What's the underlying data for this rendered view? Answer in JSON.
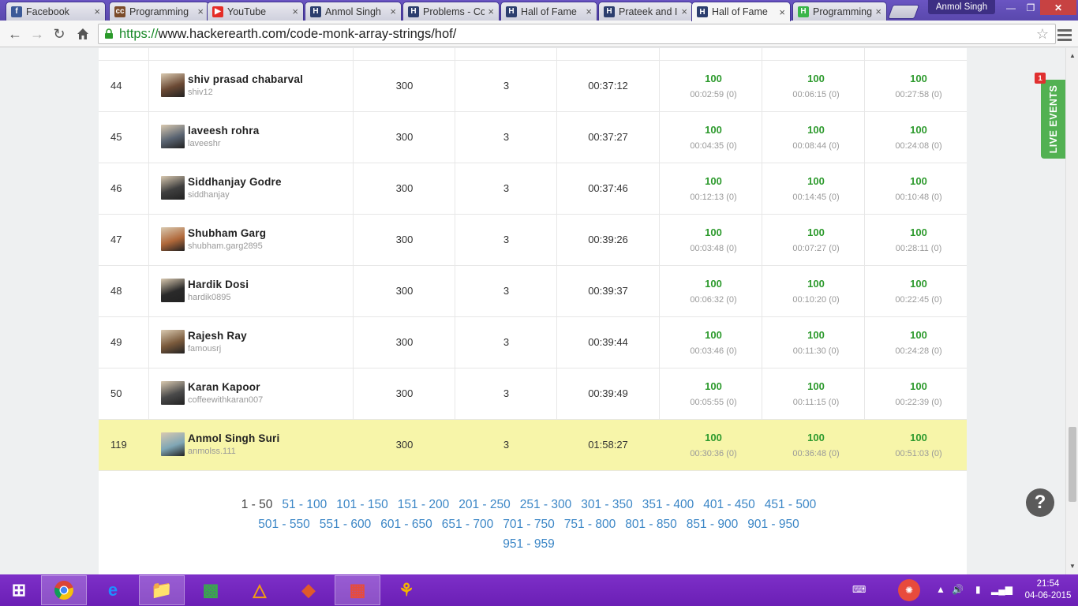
{
  "browser": {
    "tabs": [
      {
        "label": "Facebook",
        "icon": "facebook-icon",
        "color": "#3b5998",
        "glyph": "f"
      },
      {
        "label": "Programming",
        "icon": "codechef-icon",
        "color": "#7b4b2a",
        "glyph": "cc"
      },
      {
        "label": "YouTube",
        "icon": "youtube-icon",
        "color": "#e52d27",
        "glyph": "▶"
      },
      {
        "label": "Anmol Singh",
        "icon": "hackerearth-icon",
        "color": "#2c3e6e",
        "glyph": "H"
      },
      {
        "label": "Problems - Co",
        "icon": "hackerearth-icon",
        "color": "#2c3e6e",
        "glyph": "H"
      },
      {
        "label": "Hall of Fame",
        "icon": "hackerearth-icon",
        "color": "#2c3e6e",
        "glyph": "H"
      },
      {
        "label": "Prateek and I",
        "icon": "hackerearth-icon",
        "color": "#2c3e6e",
        "glyph": "H"
      },
      {
        "label": "Hall of Fame",
        "icon": "hackerearth-icon",
        "color": "#2c3e6e",
        "glyph": "H",
        "active": true
      },
      {
        "label": "Programming",
        "icon": "hackerrank-icon",
        "color": "#39b54a",
        "glyph": "H"
      }
    ],
    "user": "Anmol Singh",
    "url_scheme": "https://",
    "url_rest": "www.hackerearth.com/code-monk-array-strings/hof/"
  },
  "leaderboard": {
    "rows": [
      {
        "rank": "44",
        "name": "shiv prasad chabarval",
        "handle": "shiv12",
        "score": "300",
        "solved": "3",
        "time": "00:37:12",
        "problems": [
          {
            "score": "100",
            "time": "00:02:59 (0)"
          },
          {
            "score": "100",
            "time": "00:06:15 (0)"
          },
          {
            "score": "100",
            "time": "00:27:58 (0)"
          }
        ],
        "avatar": "#6b4a35"
      },
      {
        "rank": "45",
        "name": "laveesh rohra",
        "handle": "laveeshr",
        "score": "300",
        "solved": "3",
        "time": "00:37:27",
        "problems": [
          {
            "score": "100",
            "time": "00:04:35 (0)"
          },
          {
            "score": "100",
            "time": "00:08:44 (0)"
          },
          {
            "score": "100",
            "time": "00:24:08 (0)"
          }
        ],
        "avatar": "#5a6472"
      },
      {
        "rank": "46",
        "name": "Siddhanjay Godre",
        "handle": "siddhanjay",
        "score": "300",
        "solved": "3",
        "time": "00:37:46",
        "problems": [
          {
            "score": "100",
            "time": "00:12:13 (0)"
          },
          {
            "score": "100",
            "time": "00:14:45 (0)"
          },
          {
            "score": "100",
            "time": "00:10:48 (0)"
          }
        ],
        "avatar": "#3f3f3f"
      },
      {
        "rank": "47",
        "name": "Shubham Garg",
        "handle": "shubham.garg2895",
        "score": "300",
        "solved": "3",
        "time": "00:39:26",
        "problems": [
          {
            "score": "100",
            "time": "00:03:48 (0)"
          },
          {
            "score": "100",
            "time": "00:07:27 (0)"
          },
          {
            "score": "100",
            "time": "00:28:11 (0)"
          }
        ],
        "avatar": "#b0683a"
      },
      {
        "rank": "48",
        "name": "Hardik Dosi",
        "handle": "hardik0895",
        "score": "300",
        "solved": "3",
        "time": "00:39:37",
        "problems": [
          {
            "score": "100",
            "time": "00:06:32 (0)"
          },
          {
            "score": "100",
            "time": "00:10:20 (0)"
          },
          {
            "score": "100",
            "time": "00:22:45 (0)"
          }
        ],
        "avatar": "#2a2a2a"
      },
      {
        "rank": "49",
        "name": "Rajesh Ray",
        "handle": "famousrj",
        "score": "300",
        "solved": "3",
        "time": "00:39:44",
        "problems": [
          {
            "score": "100",
            "time": "00:03:46 (0)"
          },
          {
            "score": "100",
            "time": "00:11:30 (0)"
          },
          {
            "score": "100",
            "time": "00:24:28 (0)"
          }
        ],
        "avatar": "#7a5a3c"
      },
      {
        "rank": "50",
        "name": "Karan Kapoor",
        "handle": "coffeewithkaran007",
        "score": "300",
        "solved": "3",
        "time": "00:39:49",
        "problems": [
          {
            "score": "100",
            "time": "00:05:55 (0)"
          },
          {
            "score": "100",
            "time": "00:11:15 (0)"
          },
          {
            "score": "100",
            "time": "00:22:39 (0)"
          }
        ],
        "avatar": "#4a4a4a"
      },
      {
        "rank": "119",
        "name": "Anmol Singh Suri",
        "handle": "anmolss.111",
        "score": "300",
        "solved": "3",
        "time": "01:58:27",
        "problems": [
          {
            "score": "100",
            "time": "00:30:36 (0)"
          },
          {
            "score": "100",
            "time": "00:36:48 (0)"
          },
          {
            "score": "100",
            "time": "00:51:03 (0)"
          }
        ],
        "avatar": "#7fa6b5",
        "highlight": true
      }
    ],
    "colors": {
      "score_green": "#2d9a2d",
      "highlight": "#f7f5a9"
    }
  },
  "pagination": [
    [
      "1 - 50",
      "51 - 100",
      "101 - 150",
      "151 - 200",
      "201 - 250",
      "251 - 300",
      "301 - 350",
      "351 - 400",
      "401 - 450",
      "451 - 500"
    ],
    [
      "501 - 550",
      "551 - 600",
      "601 - 650",
      "651 - 700",
      "701 - 750",
      "751 - 800",
      "801 - 850",
      "851 - 900",
      "901 - 950"
    ],
    [
      "951 - 959"
    ]
  ],
  "live_events": {
    "label": "LIVE EVENTS",
    "count": "1"
  },
  "help": {
    "glyph": "?"
  },
  "taskbar": {
    "items": [
      "windows-start-icon",
      "chrome-icon",
      "internet-explorer-icon",
      "file-explorer-icon",
      "windows-store-icon",
      "vlc-icon",
      "git-icon",
      "winrar-icon",
      "paint-icon"
    ],
    "time": "21:54",
    "date": "04-06-2015"
  }
}
